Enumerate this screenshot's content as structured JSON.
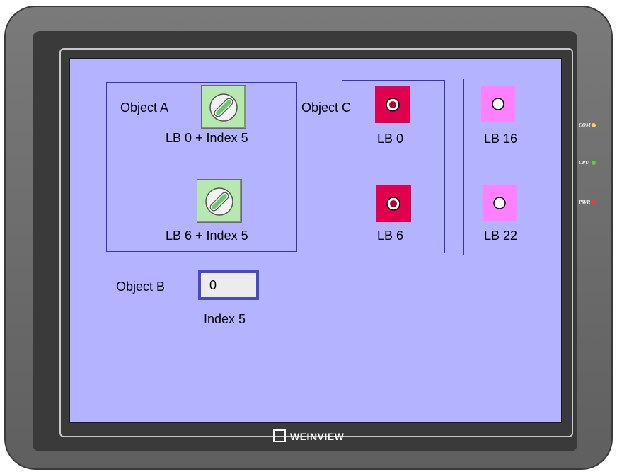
{
  "device": {
    "brand": "WEINVIEW",
    "leds": [
      {
        "label": "COM",
        "color": "#ffd633"
      },
      {
        "label": "CPU",
        "color": "#66cc33"
      },
      {
        "label": "PWR",
        "color": "#ff3333"
      }
    ]
  },
  "screen": {
    "background": "#b3b3ff",
    "object_a": {
      "label": "Object A",
      "switches": [
        {
          "caption": "LB 0 + Index 5",
          "icon": "rotary-selector-icon"
        },
        {
          "caption": "LB 6 + Index 5",
          "icon": "rotary-selector-icon"
        }
      ]
    },
    "object_b": {
      "label": "Object B",
      "value": "0",
      "caption": "Index 5"
    },
    "object_c": {
      "label": "Object C",
      "lamps": [
        {
          "caption": "LB 0",
          "state": "on",
          "color": "#e0004d"
        },
        {
          "caption": "LB 6",
          "state": "on",
          "color": "#e0004d"
        }
      ]
    },
    "lamps_right": [
      {
        "caption": "LB 16",
        "state": "off",
        "color": "#ff80ff"
      },
      {
        "caption": "LB 22",
        "state": "off",
        "color": "#ff80ff"
      }
    ]
  }
}
